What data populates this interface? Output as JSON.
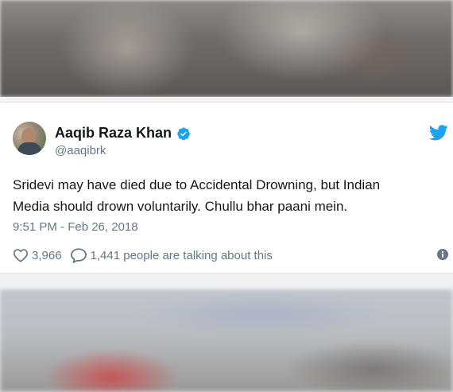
{
  "tweet": {
    "display_name": "Aaqib Raza Khan",
    "handle": "@aaqibrk",
    "text_line1": "Sridevi may have died due to Accidental Drowning, but Indian",
    "text_line2": "Media should drown voluntarily. Chullu bhar paani mein.",
    "timestamp": "9:51 PM - Feb 26, 2018",
    "likes": "3,966",
    "talking": "1,441 people are talking about this"
  },
  "icons": {
    "verified": "verified-badge-icon",
    "brand": "twitter-bird-icon",
    "like": "heart-icon",
    "reply": "speech-bubble-icon",
    "info": "info-icon"
  },
  "colors": {
    "brand_blue": "#1da1f2",
    "text_primary": "#14171a",
    "text_secondary": "#657786"
  }
}
